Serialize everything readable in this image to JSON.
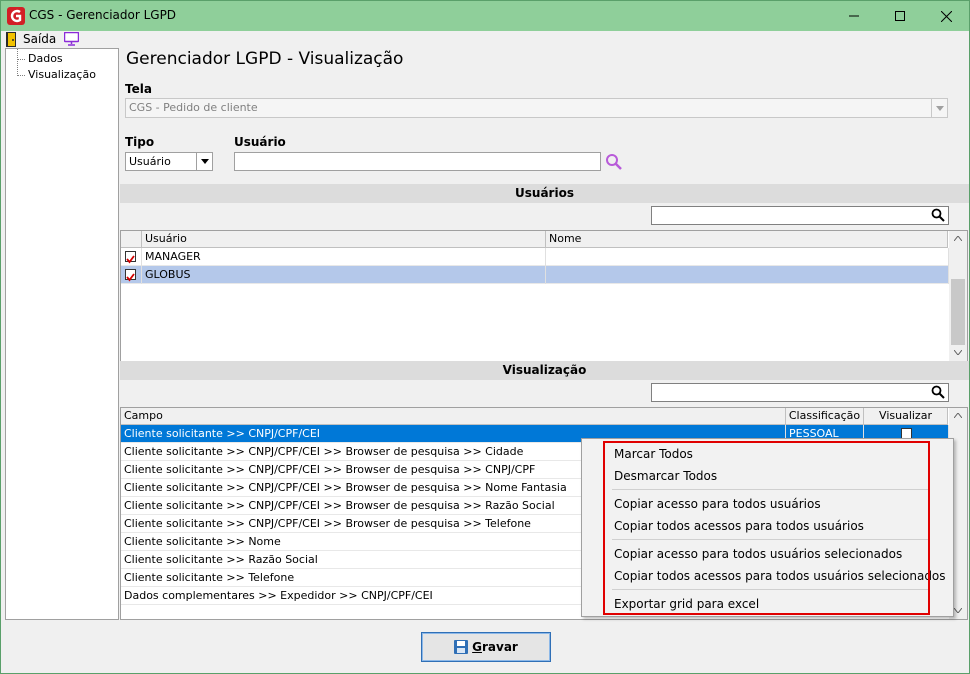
{
  "window": {
    "title": "CGS - Gerenciador LGPD",
    "colors": {
      "titlebar": "#8fcf9a",
      "selection": "#0078d7",
      "highlight_border": "#e00000"
    }
  },
  "toolbar": {
    "exit_label": "Saída",
    "exit_icon": "exit-door-icon",
    "monitor_icon": "monitor-icon"
  },
  "tree": {
    "items": [
      {
        "label": "Dados"
      },
      {
        "label": "Visualização"
      }
    ]
  },
  "page": {
    "title": "Gerenciador LGPD - Visualização"
  },
  "tela": {
    "label": "Tela",
    "value": "CGS - Pedido de cliente"
  },
  "tipo": {
    "label": "Tipo",
    "value": "Usuário"
  },
  "usuario": {
    "label": "Usuário",
    "value": ""
  },
  "users_section": {
    "title": "Usuários",
    "columns": [
      "Usuário",
      "Nome"
    ],
    "rows": [
      {
        "user": "MANAGER",
        "name": "",
        "checked": true,
        "selected": false
      },
      {
        "user": "GLOBUS",
        "name": "",
        "checked": true,
        "selected": true
      }
    ]
  },
  "view_section": {
    "title": "Visualização",
    "columns": [
      "Campo",
      "Classificação",
      "Visualizar"
    ],
    "rows": [
      {
        "campo": "Cliente solicitante >> CNPJ/CPF/CEI",
        "classificacao": "PESSOAL",
        "selected": true
      },
      {
        "campo": "Cliente solicitante >> CNPJ/CPF/CEI >> Browser de pesquisa >> Cidade"
      },
      {
        "campo": "Cliente solicitante >> CNPJ/CPF/CEI >> Browser de pesquisa >> CNPJ/CPF"
      },
      {
        "campo": "Cliente solicitante >> CNPJ/CPF/CEI >> Browser de pesquisa >> Nome Fantasia"
      },
      {
        "campo": "Cliente solicitante >> CNPJ/CPF/CEI >> Browser de pesquisa >> Razão Social"
      },
      {
        "campo": "Cliente solicitante >> CNPJ/CPF/CEI >> Browser de pesquisa >> Telefone"
      },
      {
        "campo": "Cliente solicitante >> Nome"
      },
      {
        "campo": "Cliente solicitante >> Razão Social"
      },
      {
        "campo": "Cliente solicitante >> Telefone"
      },
      {
        "campo": "Dados complementares >> Expedidor >> CNPJ/CPF/CEI"
      }
    ]
  },
  "context_menu": {
    "items": [
      "Marcar Todos",
      "Desmarcar Todos",
      "Copiar acesso para todos usuários",
      "Copiar todos acessos para todos usuários",
      "Copiar acesso para todos usuários selecionados",
      "Copiar todos acessos para todos usuários selecionados",
      "Exportar grid para excel"
    ]
  },
  "footer": {
    "save_label": "Gravar"
  }
}
